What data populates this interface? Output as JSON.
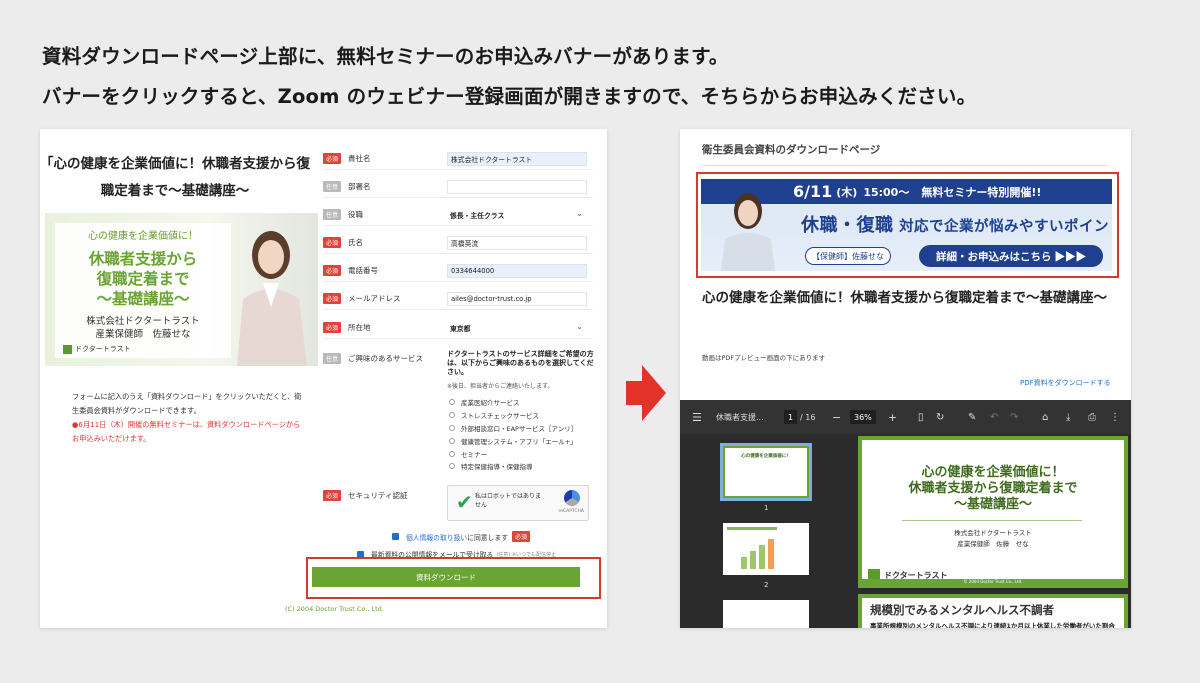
{
  "headline": {
    "line1": "資料ダウンロードページ上部に、無料セミナーのお申込みバナーがあります。",
    "line2": "バナーをクリックすると、Zoom のウェビナー登録画面が開きますので、そちらからお申込みください。"
  },
  "left": {
    "title": "「心の健康を企業価値に！休職者支援から復職定着まで〜基礎講座〜",
    "banner": {
      "sub": "心の健康を企業価値に！",
      "main_line1": "休職者支援から",
      "main_line2": "復職定着まで",
      "main_line3": "〜基礎講座〜",
      "company": "株式会社ドクタートラスト",
      "presenter": "産業保健師　佐藤せな",
      "logo": "ドクタートラスト"
    },
    "desc": "フォームに記入のうえ「資料ダウンロード」をクリックいただくと、衛生委員会資料がダウンロードできます。",
    "note": "●6月11日（木）開催の無料セミナーは、資料ダウンロードページからお申込みいただけます。",
    "copyright": "(C) 2004 Doctor Trust Co., Ltd.",
    "badges": {
      "required": "必須",
      "optional": "任意"
    },
    "form": [
      {
        "label": "貴社名",
        "value": "株式会社ドクタートラスト",
        "required": true
      },
      {
        "label": "部署名",
        "value": "",
        "required": false
      },
      {
        "label": "役職",
        "value": "係長・主任クラス",
        "required": false
      },
      {
        "label": "氏名",
        "value": "高橋英流",
        "required": true
      },
      {
        "label": "電話番号",
        "value": "0334644000",
        "required": true
      },
      {
        "label": "メールアドレス",
        "value": "ailes@doctor-trust.co.jp",
        "required": true
      },
      {
        "label": "所在地",
        "value": "東京都",
        "required": true
      }
    ],
    "services": {
      "label": "ご興味のあるサービス",
      "desc": "ドクタートラストのサービス詳細をご希望の方は、以下からご興味のあるものを選択してください。",
      "small": "※後日、担当者からご連絡いたします。",
      "items": [
        "産業医紹介サービス",
        "ストレスチェックサービス",
        "外部相談窓口・EAPサービス［アンリ］",
        "健康管理システム・アプリ「エール+」",
        "セミナー",
        "特定保健指導・保健指導"
      ]
    },
    "security": {
      "label": "セキュリティ認証",
      "captcha_text": "私はロボットではありません",
      "captcha_brand": "reCAPTCHA"
    },
    "agree1": {
      "link": "個人情報の取り扱い",
      "text": "に同意します"
    },
    "agree2": {
      "text": "最新資料の公開情報をメールで受け取る",
      "small": "(任意) ※いつでも配信停止"
    },
    "download_button": "資料ダウンロード"
  },
  "right": {
    "header": "衛生委員会資料のダウンロードページ",
    "seminar": {
      "date": "6/11",
      "day": "(木)",
      "time": "15:00〜",
      "headline": "無料セミナー特別開催!!",
      "main_big": "休職・復職",
      "main_rest": "対応で企業が悩みやすいポイント",
      "presenter": "【保健師】佐藤せな",
      "button": "詳細・お申込みはこちら ▶▶▶"
    },
    "title": "心の健康を企業価値に！休職者支援から復職定着まで〜基礎講座〜",
    "note": "動画はPDFプレビュー画面の下にあります",
    "pdf_link": "PDF資料をダウンロードする",
    "viewer": {
      "doc_name": "休職者支援...",
      "page_current": "1",
      "page_total": "/ 16",
      "zoom": "36%",
      "thumb1": "1",
      "thumb2": "2",
      "page1_title_line1": "心の健康を企業価値に！",
      "page1_title_line2": "休職者支援から復職定着まで",
      "page1_title_line3": "〜基礎講座〜",
      "page1_company": "株式会社ドクタートラスト",
      "page1_presenter": "産業保健師　佐藤　せな",
      "page1_logo": "ドクタートラスト",
      "page1_copy": "© 2004 Doctor Trust Co., Ltd.",
      "page2_title": "規模別でみるメンタルヘルス不調者",
      "page2_sub": "事業所規模別のメンタルヘルス不調により連続1か月以上休業した労働者がいた割合"
    }
  },
  "colors": {
    "accent_green": "#6aa534",
    "alert_red": "#d6392f",
    "navy": "#1f3f8f"
  }
}
